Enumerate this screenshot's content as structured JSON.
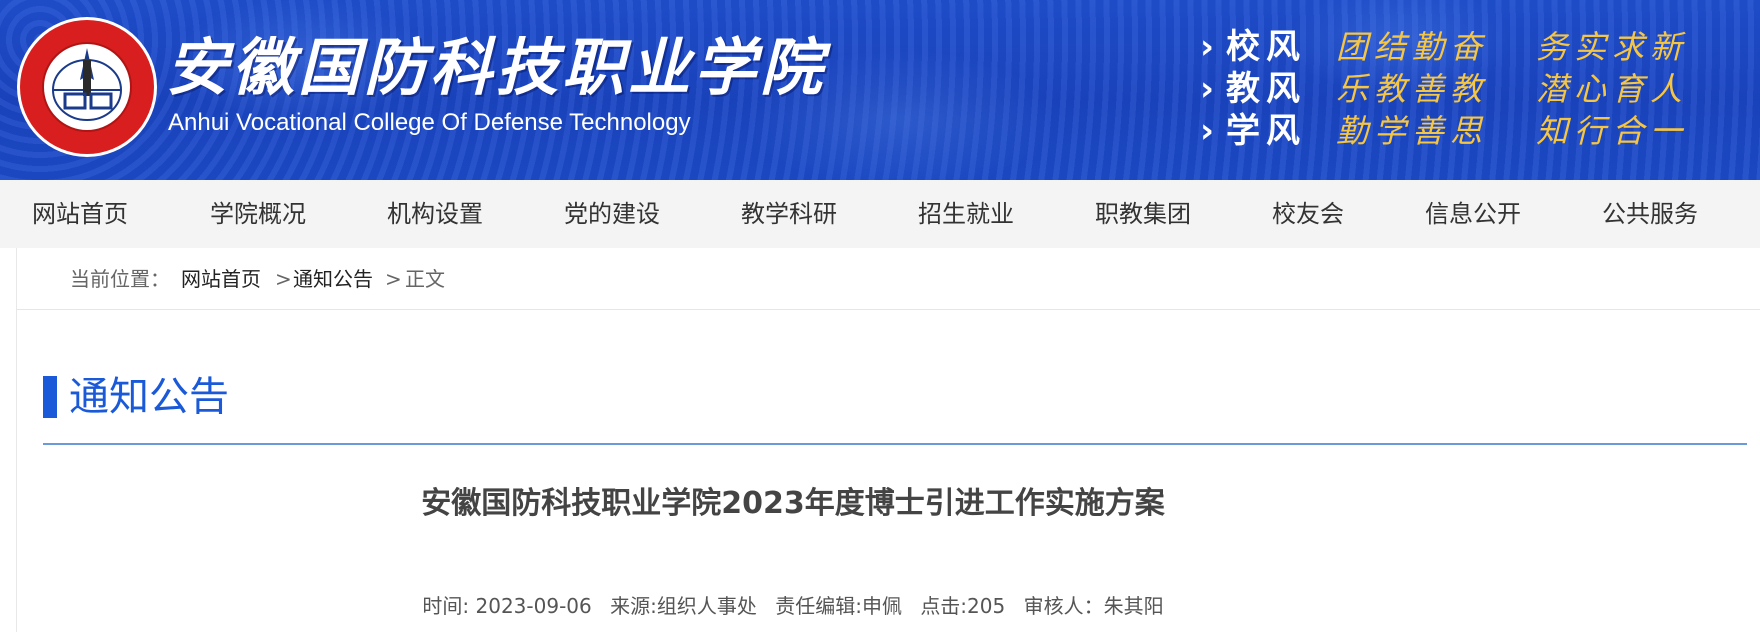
{
  "header": {
    "college_name_cn": "安徽国防科技职业学院",
    "college_name_en": "Anhui Vocational College Of Defense Technology",
    "logo_text": "安徽国防科技职业学院",
    "logo_en": "Anhui Vocational College of Defense Technology",
    "motto": [
      {
        "key": "校风",
        "value1": "团结勤奋",
        "value2": "务实求新"
      },
      {
        "key": "教风",
        "value1": "乐教善教",
        "value2": "潜心育人"
      },
      {
        "key": "学风",
        "value1": "勤学善思",
        "value2": "知行合一"
      }
    ],
    "colors": {
      "banner": "#1c4bc9",
      "motto_gold": "#f5c544",
      "logo_red": "#d81e1e"
    }
  },
  "nav": {
    "items": [
      "网站首页",
      "学院概况",
      "机构设置",
      "党的建设",
      "教学科研",
      "招生就业",
      "职教集团",
      "校友会",
      "信息公开",
      "公共服务"
    ]
  },
  "breadcrumb": {
    "label": "当前位置：",
    "home": "网站首页",
    "sep1": ">",
    "category": "通知公告",
    "sep2": ">",
    "current": "正文"
  },
  "section": {
    "title": "通知公告",
    "accent": "#1a5ad8"
  },
  "article": {
    "title": "安徽国防科技职业学院2023年度博士引进工作实施方案",
    "meta": {
      "time": "时间: 2023-09-06",
      "source": "来源:组织人事处",
      "editor": "责任编辑:申佩",
      "clicks": "点击:205",
      "reviewer": "审核人：朱其阳"
    }
  }
}
